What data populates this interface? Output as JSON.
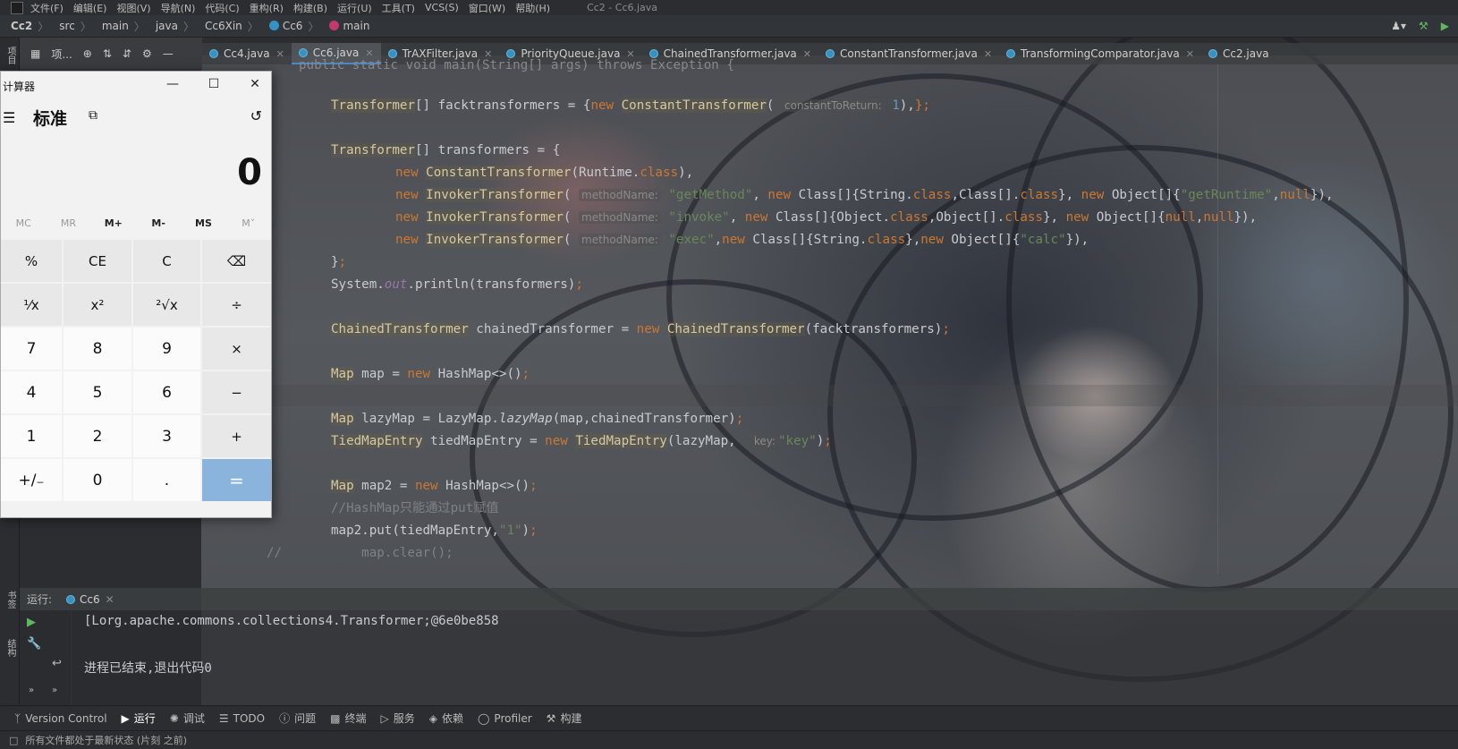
{
  "window": {
    "title": "Cc2 - Cc6.java",
    "menu": [
      "文件(F)",
      "编辑(E)",
      "视图(V)",
      "导航(N)",
      "代码(C)",
      "重构(R)",
      "构建(B)",
      "运行(U)",
      "工具(T)",
      "VCS(S)",
      "窗口(W)",
      "帮助(H)"
    ]
  },
  "breadcrumb": [
    "Cc2",
    "src",
    "main",
    "java",
    "Cc6Xin",
    "Cc6",
    "main"
  ],
  "project_panel": {
    "label": "项..."
  },
  "left_strip": {
    "top_label": "项目",
    "bookmarks_label": "书签",
    "structure_label": "结构"
  },
  "tabs": [
    {
      "label": "Cc4.java",
      "active": false
    },
    {
      "label": "Cc6.java",
      "active": true
    },
    {
      "label": "TrAXFilter.java",
      "active": false
    },
    {
      "label": "PriorityQueue.java",
      "active": false
    },
    {
      "label": "ChainedTransformer.java",
      "active": false
    },
    {
      "label": "ConstantTransformer.java",
      "active": false
    },
    {
      "label": "TransformingComparator.java",
      "active": false
    },
    {
      "label": "Cc2.java",
      "active": false
    }
  ],
  "code": {
    "l0": "public static void main(String[] args) throws Exception {",
    "hints": {
      "constantToReturn": "constantToReturn:",
      "methodName": "methodName:",
      "key": "key:"
    },
    "comment_hashmap": "//HashMap只能通过put赋值",
    "comment_clear": "//",
    "line_clear": "    map.clear();"
  },
  "calculator": {
    "title": "计算器",
    "mode": "标准",
    "display": "0",
    "memory": [
      "MC",
      "MR",
      "M+",
      "M-",
      "MS",
      "M˅"
    ],
    "keys": [
      "%",
      "CE",
      "C",
      "⌫",
      "¹⁄x",
      "x²",
      "²√x",
      "÷",
      "7",
      "8",
      "9",
      "×",
      "4",
      "5",
      "6",
      "−",
      "1",
      "2",
      "3",
      "+",
      "+/₋",
      "0",
      ".",
      "="
    ]
  },
  "run": {
    "label": "运行:",
    "tab": "Cc6",
    "output_line1": "[Lorg.apache.commons.collections4.Transformer;@6e0be858",
    "output_line2": "进程已结束,退出代码0"
  },
  "bottom_tools": [
    "Version Control",
    "运行",
    "调试",
    "TODO",
    "问题",
    "终端",
    "服务",
    "依赖",
    "Profiler",
    "构建"
  ],
  "status": "所有文件都处于最新状态 (片刻 之前)"
}
